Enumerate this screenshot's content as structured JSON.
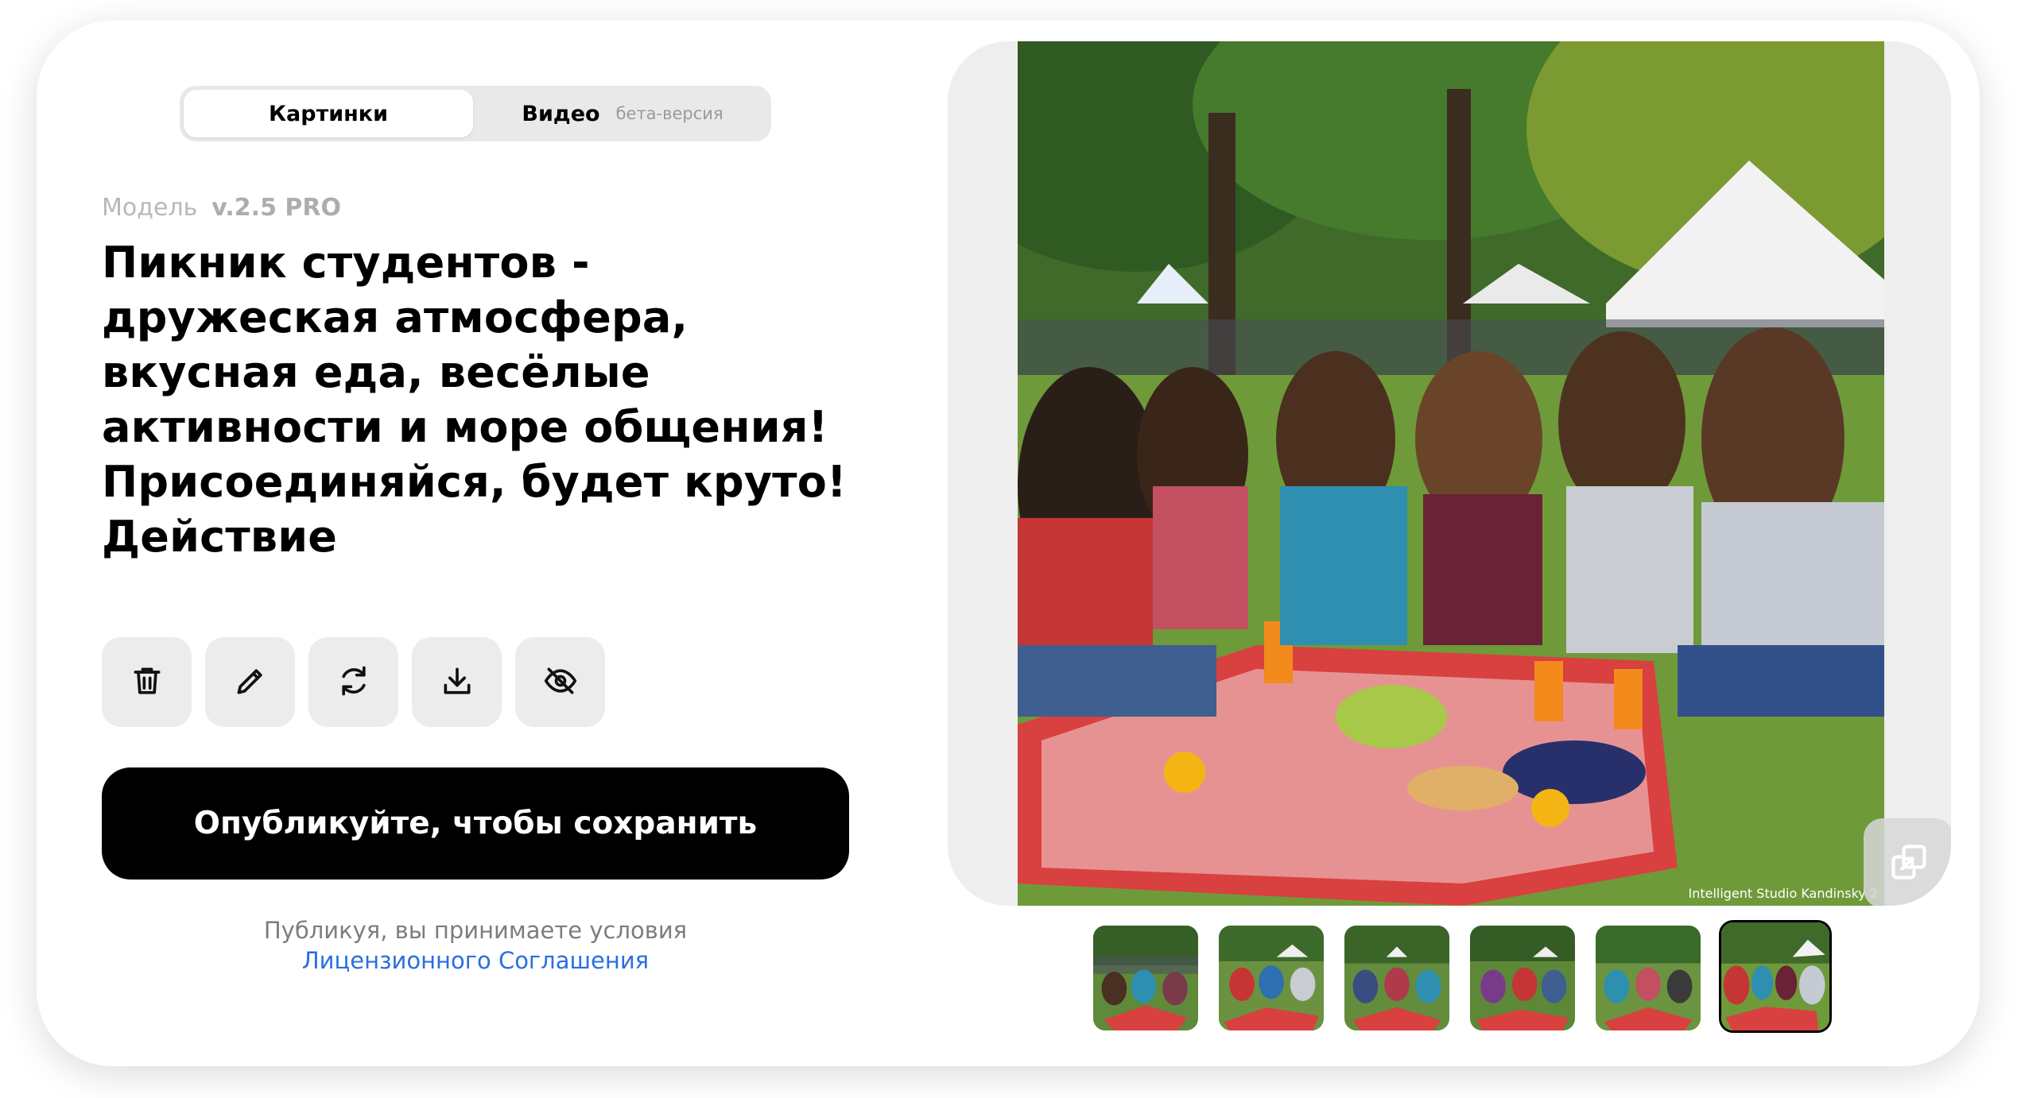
{
  "tabs": {
    "images_label": "Картинки",
    "video_label": "Видео",
    "video_badge": "бета-версия"
  },
  "model": {
    "label": "Модель",
    "version": "v.2.5 PRO"
  },
  "prompt": {
    "text": "Пикник студентов - дружеская атмосфера, вкусная еда, весёлые активности и море общения! Присоединяйся, будет круто! Действие"
  },
  "actions": {
    "icons": [
      "trash-icon",
      "pencil-icon",
      "refresh-icon",
      "download-icon",
      "eye-off-icon"
    ]
  },
  "publish": {
    "label": "Опубликуйте, чтобы сохранить"
  },
  "terms": {
    "line1": "Публикуя, вы принимаете условия",
    "link": "Лицензионного Соглашения"
  },
  "image": {
    "watermark": "Intelligent Studio Kandinsky 2",
    "thumbnail_count": 6,
    "selected_thumbnail": 6
  },
  "colors": {
    "accent_link": "#2a6fe0",
    "button_bg": "#000000",
    "tab_bg": "#e9e9e9",
    "action_bg": "#ececec"
  }
}
